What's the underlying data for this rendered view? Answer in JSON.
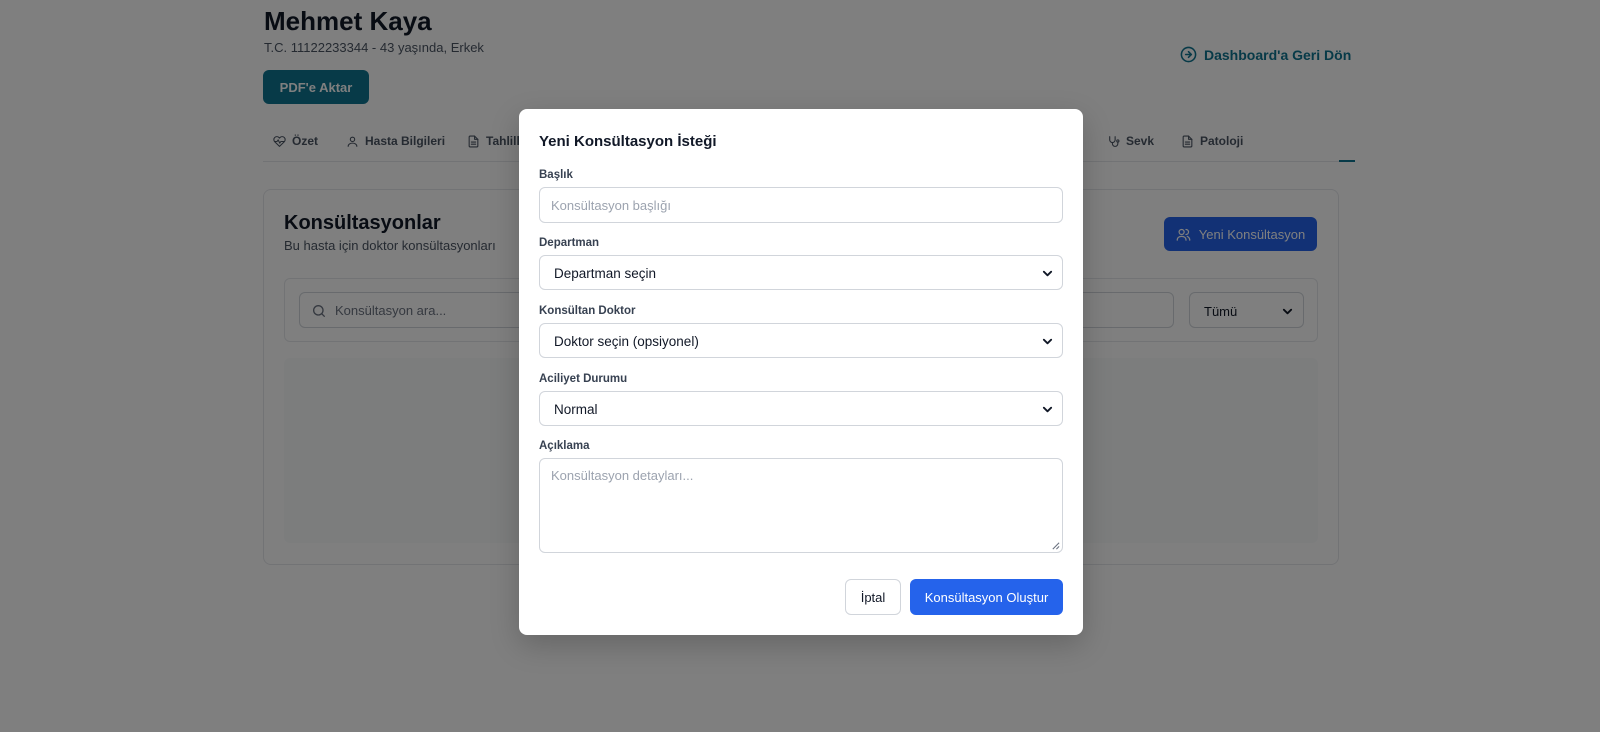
{
  "patient": {
    "name": "Mehmet Kaya",
    "meta": "T.C. 11122233344 - 43 yaşında, Erkek"
  },
  "header": {
    "back_label": "Dashboard'a Geri Dön",
    "pdf_label": "PDF'e Aktar"
  },
  "tabs": [
    {
      "label": "Özet",
      "icon": "heart-pulse-icon"
    },
    {
      "label": "Hasta Bilgileri",
      "icon": "user-icon"
    },
    {
      "label": "Tahlille",
      "icon": "file-text-icon"
    },
    {
      "label": "Sevk",
      "icon": "stethoscope-icon"
    },
    {
      "label": "Patoloji",
      "icon": "file-text-icon"
    }
  ],
  "card": {
    "title": "Konsültasyonlar",
    "subtitle": "Bu hasta için doktor konsültasyonları",
    "new_button": "Yeni Konsültasyon",
    "search_placeholder": "Konsültasyon ara...",
    "status_filter": "Tümü"
  },
  "modal": {
    "title": "Yeni Konsültasyon İsteği",
    "title_label": "Başlık",
    "title_placeholder": "Konsültasyon başlığı",
    "department_label": "Departman",
    "department_value": "Departman seçin",
    "doctor_label": "Konsültan Doktor",
    "doctor_value": "Doktor seçin (opsiyonel)",
    "urgency_label": "Aciliyet Durumu",
    "urgency_value": "Normal",
    "description_label": "Açıklama",
    "description_placeholder": "Konsültasyon detayları...",
    "cancel_label": "İptal",
    "submit_label": "Konsültasyon Oluştur"
  },
  "colors": {
    "primary": "#2563eb",
    "teal": "#0e7490",
    "overlay": "rgba(0,0,0,0.5)"
  }
}
